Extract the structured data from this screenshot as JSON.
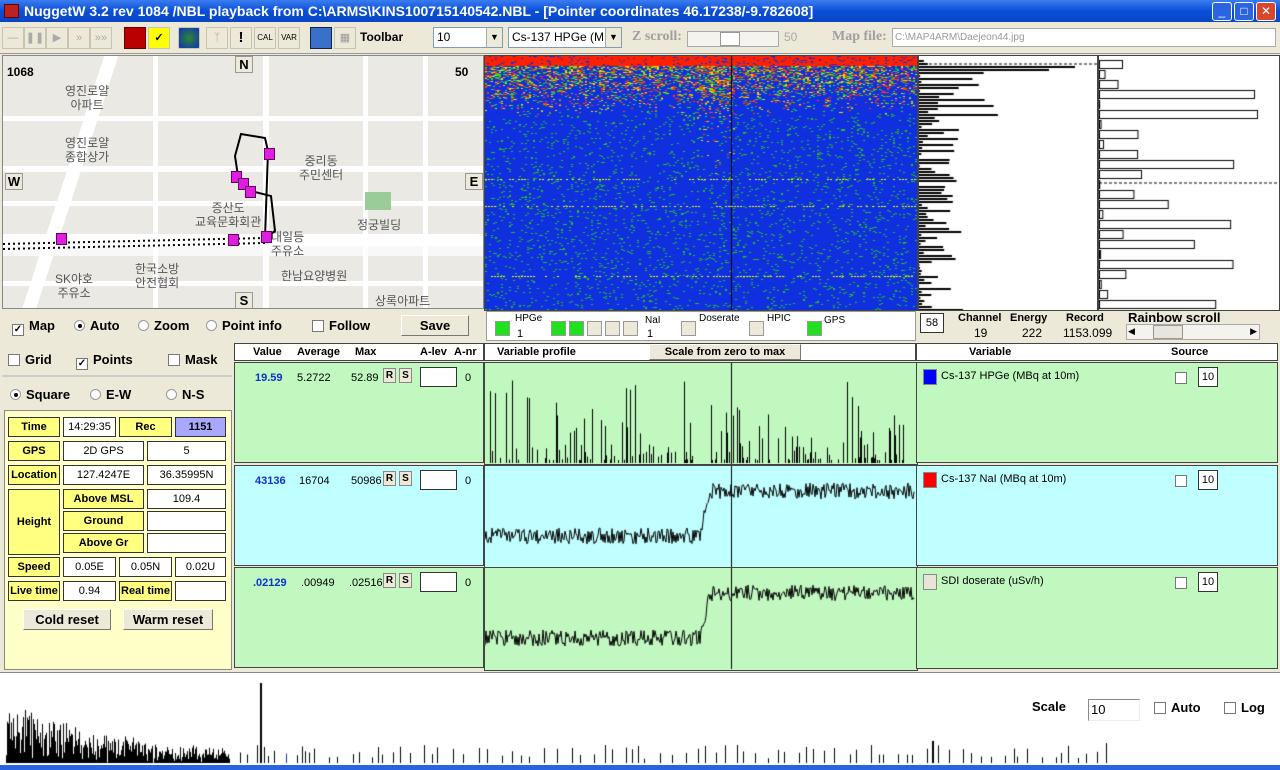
{
  "window": {
    "title": "NuggetW  3.2 rev 1084 /NBL playback from C:\\ARMS\\KINS100715140542.NBL - [Pointer coordinates 46.17238/-9.782608]",
    "minimize": "_",
    "maximize": "□",
    "close": "✕"
  },
  "toolbar": {
    "label": "Toolbar",
    "cal": "CAL",
    "var": "VAR",
    "count_value": "10",
    "variable_value": "Cs-137 HPGe (M",
    "zscroll_label": "Z scroll:",
    "zscroll_value": "50",
    "mapfile_label": "Map file:",
    "mapfile_value": "C:\\MAP4ARM\\Daejeon44.jpg"
  },
  "map": {
    "corner_left": "1068",
    "corner_right": "50",
    "compass": {
      "n": "N",
      "s": "S",
      "e": "E",
      "w": "W"
    },
    "labels": [
      "영진로얄\n아파트",
      "영진로얄\n종합상가",
      "중리동\n주민센터",
      "증산도\n교육문화회관",
      "대일등\n주유소",
      "정궁빌딩",
      "SK야호\n주유소",
      "한국소방\n안전협회",
      "한남요양병원",
      "상록아파트"
    ]
  },
  "map_controls": {
    "map": "Map",
    "auto": "Auto",
    "zoom": "Zoom",
    "point_info": "Point info",
    "follow": "Follow",
    "save": "Save",
    "map_checked": true,
    "follow_checked": false,
    "selected": "Auto"
  },
  "options": {
    "grid": "Grid",
    "points": "Points",
    "mask": "Mask",
    "grid_checked": false,
    "points_checked": true,
    "mask_checked": false,
    "square": "Square",
    "ew": "E-W",
    "ns": "N-S",
    "selected": "Square"
  },
  "info": {
    "time_label": "Time",
    "time": "14:29:35",
    "rec_label": "Rec",
    "rec": "1151",
    "gps_label": "GPS",
    "gps_mode": "2D GPS",
    "gps_sats": "5",
    "location_label": "Location",
    "lon": "127.4247E",
    "lat": "36.35995N",
    "height_label": "Height",
    "msl_label": "Above MSL",
    "msl": "109.4",
    "ground_label": "Ground",
    "ground": "",
    "abovegr_label": "Above Gr",
    "abovegr": "",
    "speed_label": "Speed",
    "speed_e": "0.05E",
    "speed_n": "0.05N",
    "speed_u": "0.02U",
    "live_label": "Live time",
    "live": "0.94",
    "real_label": "Real time",
    "real": "",
    "cold_reset": "Cold reset",
    "warm_reset": "Warm reset"
  },
  "stats": {
    "headers": [
      "Value",
      "Average",
      "Max",
      "A-lev",
      "A-nr"
    ],
    "r_label": "R",
    "s_label": "S",
    "rows": [
      {
        "value": "19.59",
        "average": "5.2722",
        "max": "52.89",
        "alev": "",
        "anr": "0"
      },
      {
        "value": "43136",
        "average": "16704",
        "max": "50986",
        "alev": "",
        "anr": "0"
      },
      {
        "value": ".02129",
        "average": ".00949",
        "max": ".02516",
        "alev": "",
        "anr": "0"
      }
    ]
  },
  "indicators": {
    "hpge": "HPGe",
    "hpge_n": "1",
    "nai": "NaI",
    "nai_n": "1",
    "doserate": "Doserate",
    "hpic": "HPIC",
    "gps": "GPS"
  },
  "channel": {
    "box": "58",
    "channel_label": "Channel",
    "channel": "19",
    "energy_label": "Energy",
    "energy": "222",
    "record_label": "Record",
    "record": "1153.099",
    "rainbow_label": "Rainbow scroll"
  },
  "profile": {
    "header": "Variable profile",
    "scale_button": "Scale from zero to max"
  },
  "variables": {
    "header": "Variable",
    "source_header": "Source",
    "rows": [
      {
        "name": "Cs-137 HPGe (MBq at 10m)",
        "color": "#0000ff",
        "source": "10"
      },
      {
        "name": "Cs-137 NaI (MBq at 10m)",
        "color": "#ff0000",
        "source": "10"
      },
      {
        "name": "SDI doserate (uSv/h)",
        "color": "#e8e4d8",
        "source": "10"
      }
    ]
  },
  "spectrum": {
    "scale_label": "Scale",
    "scale_value": "10",
    "auto": "Auto",
    "log": "Log"
  },
  "colors": {
    "title": "#0a4fd8",
    "green_panel": "#c0f8c0",
    "cyan_panel": "#c0ffff",
    "info_yellow": "#ffff80",
    "track_point": "#e01ee0"
  }
}
